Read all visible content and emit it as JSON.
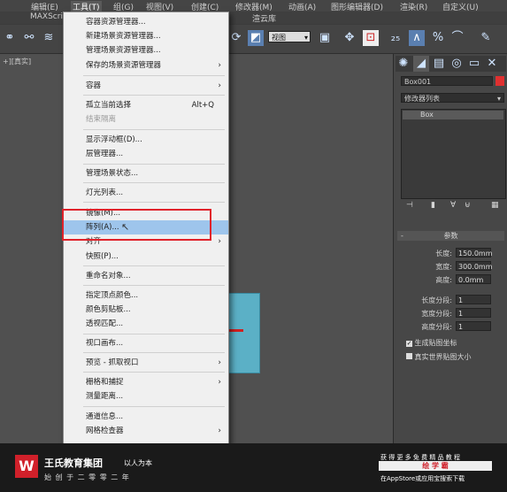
{
  "menubar": {
    "items": [
      "编辑(E)",
      "工具(T)",
      "组(G)",
      "视图(V)",
      "创建(C)",
      "修改器(M)",
      "动画(A)",
      "图形编辑器(D)",
      "渲染(R)",
      "自定义(U)"
    ],
    "second_row": [
      "MAXScri",
      "渲云库"
    ]
  },
  "toolbar": {
    "view_select": "视图"
  },
  "viewport": {
    "label": "+][真实]"
  },
  "dropdown": {
    "items": [
      {
        "label": "容器资源管理器...",
        "shortcut": "",
        "arrow": false,
        "disabled": false
      },
      {
        "label": "新建场景资源管理器...",
        "shortcut": "",
        "arrow": false,
        "disabled": false
      },
      {
        "label": "管理场景资源管理器...",
        "shortcut": "",
        "arrow": false,
        "disabled": false
      },
      {
        "label": "保存的场景资源管理器",
        "shortcut": "",
        "arrow": true,
        "disabled": false
      },
      {
        "label": "容器",
        "shortcut": "",
        "arrow": true,
        "disabled": false
      },
      {
        "label": "孤立当前选择",
        "shortcut": "Alt+Q",
        "arrow": false,
        "disabled": false
      },
      {
        "label": "结束隔离",
        "shortcut": "",
        "arrow": false,
        "disabled": true
      },
      {
        "label": "显示浮动框(D)...",
        "shortcut": "",
        "arrow": false,
        "disabled": false
      },
      {
        "label": "层管理器...",
        "shortcut": "",
        "arrow": false,
        "disabled": false
      },
      {
        "label": "管理场景状态...",
        "shortcut": "",
        "arrow": false,
        "disabled": false
      },
      {
        "label": "灯光列表...",
        "shortcut": "",
        "arrow": false,
        "disabled": false
      },
      {
        "label": "镜像(M)...",
        "shortcut": "",
        "arrow": false,
        "disabled": false
      },
      {
        "label": "阵列(A)...",
        "shortcut": "",
        "arrow": false,
        "disabled": false
      },
      {
        "label": "对齐",
        "shortcut": "",
        "arrow": true,
        "disabled": false
      },
      {
        "label": "快照(P)...",
        "shortcut": "",
        "arrow": false,
        "disabled": false
      },
      {
        "label": "重命名对象...",
        "shortcut": "",
        "arrow": false,
        "disabled": false
      },
      {
        "label": "指定顶点颜色...",
        "shortcut": "",
        "arrow": false,
        "disabled": false
      },
      {
        "label": "颜色剪贴板...",
        "shortcut": "",
        "arrow": false,
        "disabled": false
      },
      {
        "label": "透视匹配...",
        "shortcut": "",
        "arrow": false,
        "disabled": false
      },
      {
        "label": "视口画布...",
        "shortcut": "",
        "arrow": false,
        "disabled": false
      },
      {
        "label": "预览 - 抓取视口",
        "shortcut": "",
        "arrow": true,
        "disabled": false
      },
      {
        "label": "栅格和捕捉",
        "shortcut": "",
        "arrow": true,
        "disabled": false
      },
      {
        "label": "测量距离...",
        "shortcut": "",
        "arrow": false,
        "disabled": false
      },
      {
        "label": "通道信息...",
        "shortcut": "",
        "arrow": false,
        "disabled": false
      },
      {
        "label": "网格检查器",
        "shortcut": "",
        "arrow": true,
        "disabled": false
      }
    ]
  },
  "right_panel": {
    "object_name": "Box001",
    "modifier_list": "修改器列表",
    "stack_item": "Box",
    "rollout_title": "参数",
    "params": [
      {
        "label": "长度:",
        "value": "150.0mm"
      },
      {
        "label": "宽度:",
        "value": "300.0mm"
      },
      {
        "label": "高度:",
        "value": "0.0mm"
      }
    ],
    "segments": [
      {
        "label": "长度分段:",
        "value": "1"
      },
      {
        "label": "宽度分段:",
        "value": "1"
      },
      {
        "label": "高度分段:",
        "value": "1"
      }
    ],
    "checkboxes": [
      {
        "label": "生成贴图坐标",
        "checked": true
      },
      {
        "label": "真实世界贴图大小",
        "checked": false
      }
    ]
  },
  "watermark": {
    "company": "王氏教育集团",
    "slogan": "以人为本",
    "founded": "始 创 于 二 零 零 二 年",
    "promo_line1": "获 得 更 多 免 费 精 品 教 程",
    "promo_badge": "绘 学 霸",
    "promo_line2": "在AppStore或应用宝搜索下载"
  }
}
